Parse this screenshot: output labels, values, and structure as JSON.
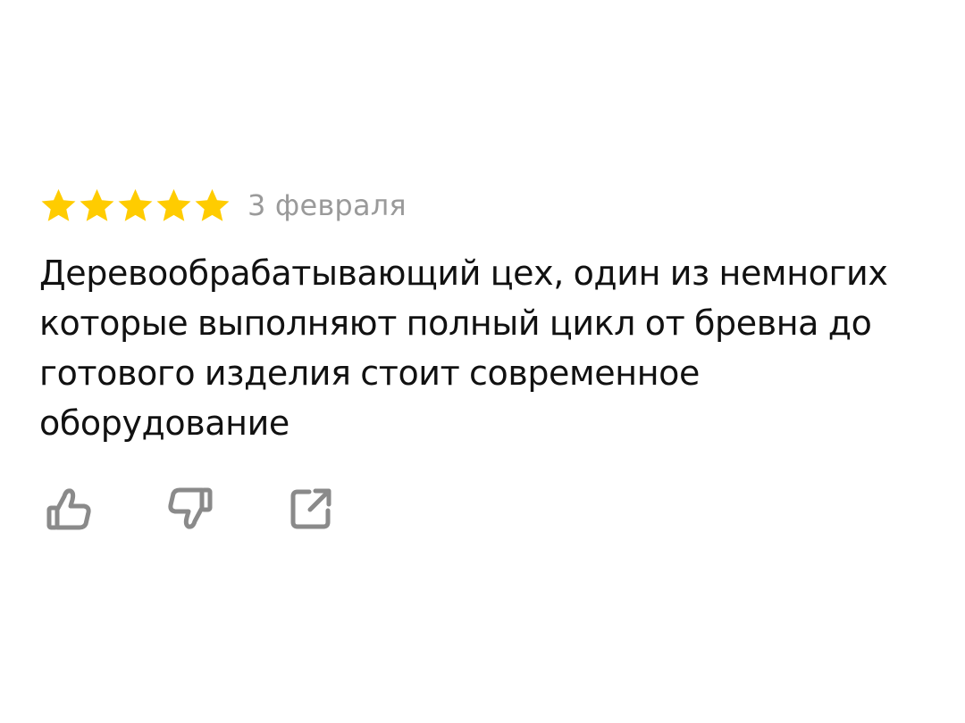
{
  "review": {
    "rating": 5,
    "rating_max": 5,
    "star_color": "#FFCC00",
    "date": "3 февраля",
    "text": "Деревообрабатывающий цех, один из немногих которые выполняют полный цикл от бревна до готового изделия стоит современное оборудование"
  },
  "actions": {
    "icon_color": "#8a8a8a",
    "like_icon": "thumbs-up-icon",
    "dislike_icon": "thumbs-down-icon",
    "share_icon": "share-external-icon"
  }
}
